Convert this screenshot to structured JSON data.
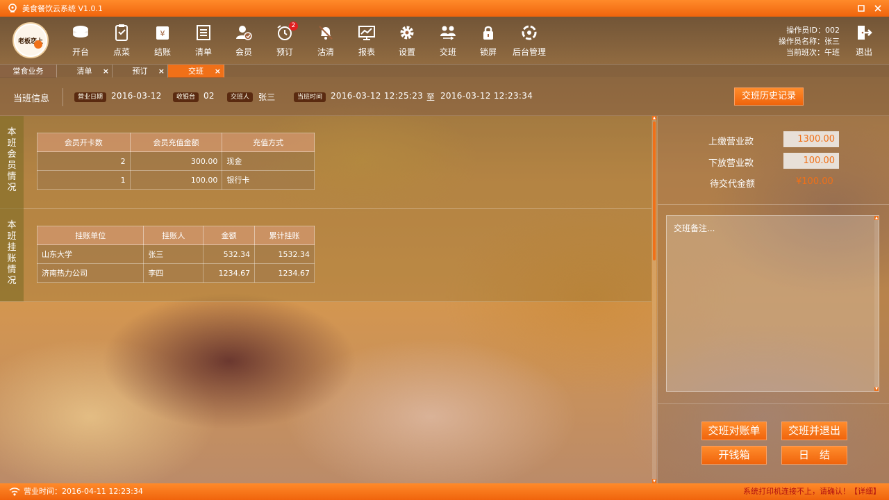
{
  "window": {
    "title": "美食餐饮云系统 V1.0.1"
  },
  "toolbar": {
    "logo_text": "老板恋上",
    "items": [
      {
        "label": "开台",
        "icon": "table-icon"
      },
      {
        "label": "点菜",
        "icon": "order-clipboard-icon"
      },
      {
        "label": "结账",
        "icon": "checkout-icon"
      },
      {
        "label": "清单",
        "icon": "list-icon"
      },
      {
        "label": "会员",
        "icon": "member-icon"
      },
      {
        "label": "预订",
        "icon": "alarm-clock-icon",
        "badge": "2"
      },
      {
        "label": "沽清",
        "icon": "bell-off-icon"
      },
      {
        "label": "报表",
        "icon": "report-chart-icon"
      },
      {
        "label": "设置",
        "icon": "gear-icon"
      },
      {
        "label": "交班",
        "icon": "handover-icon"
      },
      {
        "label": "锁屏",
        "icon": "lock-icon"
      },
      {
        "label": "后台管理",
        "icon": "backend-admin-icon"
      }
    ],
    "operator_id": "操作员ID：002",
    "operator_name": "操作员名称：张三",
    "current_shift": "当前班次：午班",
    "logout_label": "退出"
  },
  "tabs": {
    "home": "堂食业务",
    "items": [
      {
        "label": "清单",
        "close": "×"
      },
      {
        "label": "预订",
        "close": "×"
      },
      {
        "label": "交班",
        "close": "×",
        "active": true
      }
    ]
  },
  "shift": {
    "title": "当班信息",
    "business_date_label": "营业日期",
    "business_date": "2016-03-12",
    "cashier_label": "收银台",
    "cashier": "02",
    "handover_person_label": "交班人",
    "handover_person": "张三",
    "shift_time_label": "当班时间",
    "shift_start": "2016-03-12  12:25:23",
    "to": "至",
    "shift_end": "2016-03-12  12:23:34",
    "history_button": "交班历史记录"
  },
  "member_section": {
    "label": [
      "本",
      "班",
      "会",
      "员",
      "情",
      "况"
    ],
    "headers": [
      "会员开卡数",
      "会员充值金额",
      "充值方式"
    ],
    "rows": [
      [
        "2",
        "300.00",
        "现金"
      ],
      [
        "1",
        "100.00",
        "银行卡"
      ]
    ]
  },
  "credit_section": {
    "label": [
      "本",
      "班",
      "挂",
      "账",
      "情",
      "况"
    ],
    "headers": [
      "挂账单位",
      "挂账人",
      "金额",
      "累计挂账"
    ],
    "rows": [
      [
        "山东大学",
        "张三",
        "532.34",
        "1532.34"
      ],
      [
        "济南热力公司",
        "李四",
        "1234.67",
        "1234.67"
      ]
    ]
  },
  "summary": {
    "submit_label": "上缴营业款",
    "submit_value": "1300.00",
    "release_label": "下放营业款",
    "release_value": "100.00",
    "pending_label": "待交代金额",
    "pending_value": "¥100.00"
  },
  "notes": {
    "placeholder": "交班备注..."
  },
  "actions": {
    "reconcile": "交班对账单",
    "handover_exit": "交班并退出",
    "open_drawer": "开钱箱",
    "day_close": "日　结"
  },
  "status": {
    "business_time": "营业时间：2016-04-11  12:23:34",
    "warning": "系统打印机连接不上，请确认！【详细】"
  },
  "colors": {
    "accent": "#f07018",
    "pill": "#5a2a10",
    "warning": "#b01010"
  }
}
